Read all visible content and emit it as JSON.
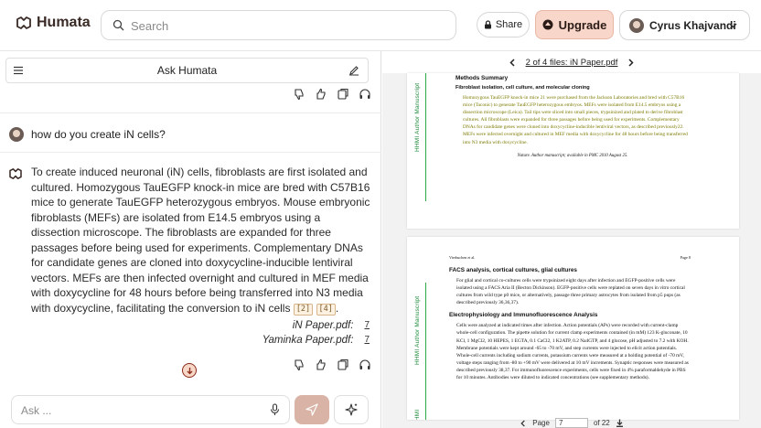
{
  "app": {
    "name": "Humata"
  },
  "header": {
    "search_placeholder": "Search",
    "share_label": "Share",
    "upgrade_label": "Upgrade",
    "user_name": "Cyrus Khajvandi"
  },
  "chat": {
    "title": "Ask Humata",
    "question": "how do you create iN cells?",
    "answer": "To create induced neuronal (iN) cells, fibroblasts are first isolated and cultured. Homozygous TauEGFP knock-in mice are bred with C57B16 mice to generate TauEGFP heterozygous embryos. Mouse embryonic fibroblasts (MEFs) are isolated from E14.5 embryos using a dissection microscope. The fibroblasts are expanded for three passages before being used for experiments. Complementary DNAs for candidate genes are cloned into doxycycline-inducible lentiviral vectors. MEFs are then infected overnight and cultured in MEF media with doxycycline for 48 hours before being transferred into N3 media with doxycycline, facilitating the conversion to iN cells",
    "citations": [
      "[2]",
      "[4]"
    ],
    "answer_end": ".",
    "sources": [
      {
        "label": "iN Paper.pdf:",
        "link": "7"
      },
      {
        "label": "Yaminka Paper.pdf:",
        "link": "7"
      }
    ],
    "composer_placeholder": "Ask ..."
  },
  "viewer": {
    "nav_text": "2 of 4 files",
    "nav_file": ": iN Paper.pdf",
    "page1": {
      "side_label": "HHMI Author Manuscript",
      "heading": "Methods Summary",
      "subheading": "Fibroblast isolation, cell culture, and molecular cloning",
      "paragraph": "Homozygous TauEGFP knock-in mice 21 were purchased from the Jackson Laboratories and bred with C57B16 mice (Taconic) to generate TauEGFP heterozygous embryos. MEFs were isolated from E14.5 embryos using a dissection microscope (Leica). Tail tips were sliced into small pieces, trypsinized and plated to derive fibroblast cultures. All fibroblasts were expanded for three passages before being used for experiments. Complementary DNAs for candidate genes were cloned into doxycycline-inducible lentiviral vectors, as described previously22. MEFs were infected overnight and cultured in MEF media with doxycycline for 48 hours before being transferred into N3 media with doxycycline.",
      "footer": "Nature. Author manuscript; available in PMC 2010 August 25."
    },
    "page2": {
      "side_label": "HHMI Author Manuscript",
      "running_head_left": "Vierbuchen et al.",
      "running_head_right": "Page 8",
      "heading1": "FACS analysis, cortical cultures, glial cultures",
      "paragraph1": "For glial and cortical co-cultures cells were trypsinized eight days after infection and EGFP-positive cells were isolated using a FACS Aria II (Becton Dickinson). EGFP-positive cells were replated on seven days in vitro cortical cultures from wild type p0 mice, or alternatively, passage three primary astrocytes from isolated from p5 pups (as described previously 36,36,37).",
      "heading2": "Electrophysiology and Immunofluorescence Analysis",
      "paragraph2": "Cells were analyzed at indicated times after infection. Action potentials (APs) were recorded with current-clamp whole-cell configuration. The pipette solution for current clamp experiments contained (in mM) 123 K-gluconate, 10 KCl, 1 MgCl2, 10 HEPES, 1 EGTA, 0.1 CaCl2, 1 K2ATP, 0.2 Na4GTP, and 4 glucose, pH adjusted to 7.2 with KOH. Membrane potentials were kept around -65 to -70 mV, and step currents were injected to elicit action potentials. Whole-cell currents including sodium currents, potassium currents were measured at a holding potential of -70 mV, voltage steps ranging from -80 to +90 mV were delivered at 10 mV increments. Synaptic responses were measured as described previously 38,37. For immunofluorescence experiments, cells were fixed in 4% paraformaldehyde in PBS for 10 minutes. Antibodies were diluted to indicated concentrations (see supplementary methods)."
    },
    "page_control": {
      "label": "Page",
      "current": "7",
      "total": "of 22"
    }
  },
  "colors": {
    "accent": "#8b2a18",
    "upgrade_bg": "#f8d6c9",
    "citation_bg": "#fdf2e2"
  }
}
